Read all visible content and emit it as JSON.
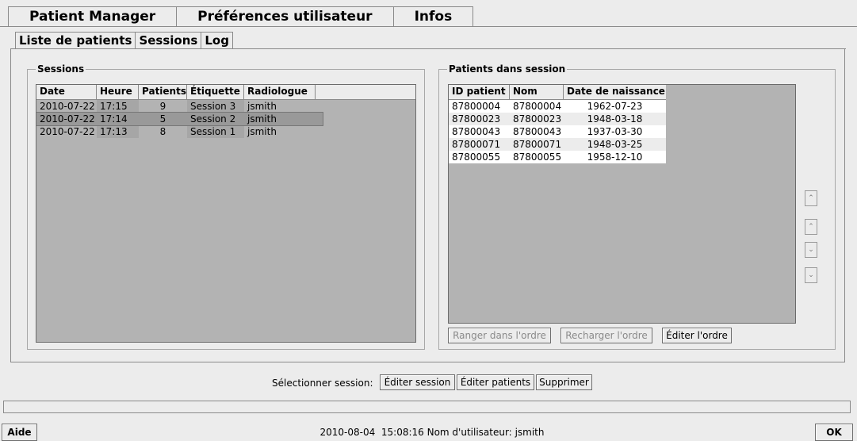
{
  "main_tabs": [
    "Patient Manager",
    "Préférences utilisateur",
    "Infos"
  ],
  "sub_tabs": [
    "Liste de patients",
    "Sessions",
    "Log"
  ],
  "sessions": {
    "title": "Sessions",
    "columns": [
      "Date",
      "Heure",
      "Patients",
      "Étiquette",
      "Radiologue"
    ],
    "rows": [
      {
        "date": "2010-07-22",
        "heure": "17:15",
        "patients": "9",
        "etiquette": "Session 3",
        "radiologue": "jsmith"
      },
      {
        "date": "2010-07-22",
        "heure": "17:14",
        "patients": "5",
        "etiquette": "Session 2",
        "radiologue": "jsmith"
      },
      {
        "date": "2010-07-22",
        "heure": "17:13",
        "patients": "8",
        "etiquette": "Session 1",
        "radiologue": "jsmith"
      }
    ]
  },
  "patients": {
    "title": "Patients dans session",
    "columns": [
      "ID patient",
      "Nom",
      "Date de naissance"
    ],
    "rows": [
      {
        "id": "87800004",
        "nom": "87800004",
        "dob": "1962-07-23"
      },
      {
        "id": "87800023",
        "nom": "87800023",
        "dob": "1948-03-18"
      },
      {
        "id": "87800043",
        "nom": "87800043",
        "dob": "1937-03-30"
      },
      {
        "id": "87800071",
        "nom": "87800071",
        "dob": "1948-03-25"
      },
      {
        "id": "87800055",
        "nom": "87800055",
        "dob": "1958-12-10"
      }
    ],
    "buttons": {
      "ranger": "Ranger dans l'ordre",
      "recharger": "Recharger l'ordre",
      "editer": "Éditer l'ordre"
    }
  },
  "bottom": {
    "select_label": "Sélectionner session:",
    "edit_session": "Éditer session",
    "edit_patients": "Éditer patients",
    "delete": "Supprimer"
  },
  "status": {
    "help": "Aide",
    "datetime": "2010-08-04  15:08:16",
    "user_label": "Nom d'utilisateur:",
    "user": "jsmith",
    "ok": "OK"
  }
}
